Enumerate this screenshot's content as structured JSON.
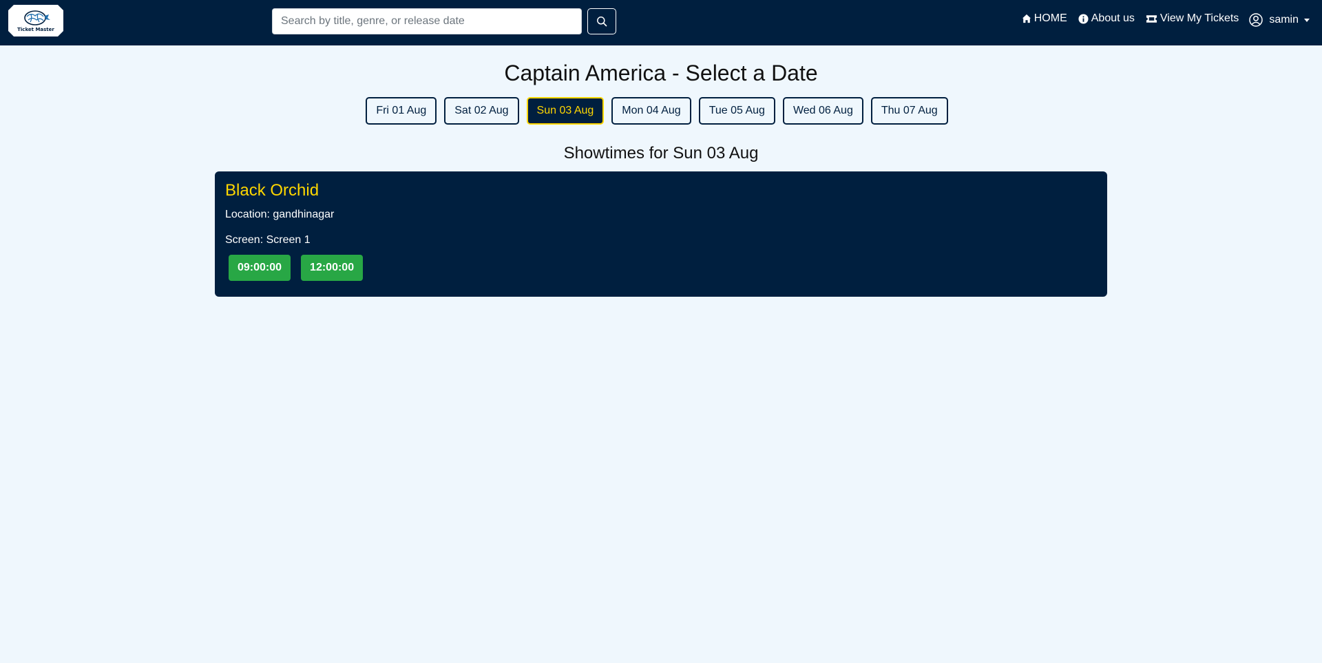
{
  "app": {
    "logo_text": "Ticket Master"
  },
  "search": {
    "placeholder": "Search by title, genre, or release date",
    "value": ""
  },
  "nav": {
    "home": "HOME",
    "about": "About us",
    "tickets": "View My Tickets",
    "user": "samin"
  },
  "page": {
    "title": "Captain America - Select a Date",
    "showtimes_heading": "Showtimes for Sun 03 Aug"
  },
  "dates": [
    {
      "label": "Fri 01 Aug",
      "active": false
    },
    {
      "label": "Sat 02 Aug",
      "active": false
    },
    {
      "label": "Sun 03 Aug",
      "active": true
    },
    {
      "label": "Mon 04 Aug",
      "active": false
    },
    {
      "label": "Tue 05 Aug",
      "active": false
    },
    {
      "label": "Wed 06 Aug",
      "active": false
    },
    {
      "label": "Thu 07 Aug",
      "active": false
    }
  ],
  "theater": {
    "name": "Black Orchid",
    "location": "Location: gandhinagar",
    "screen": "Screen: Screen 1",
    "times": [
      "09:00:00",
      "12:00:00"
    ]
  },
  "colors": {
    "navbar": "#001f3f",
    "accent": "#ffd700",
    "showtime": "#28a745",
    "background": "#eff7fd"
  }
}
